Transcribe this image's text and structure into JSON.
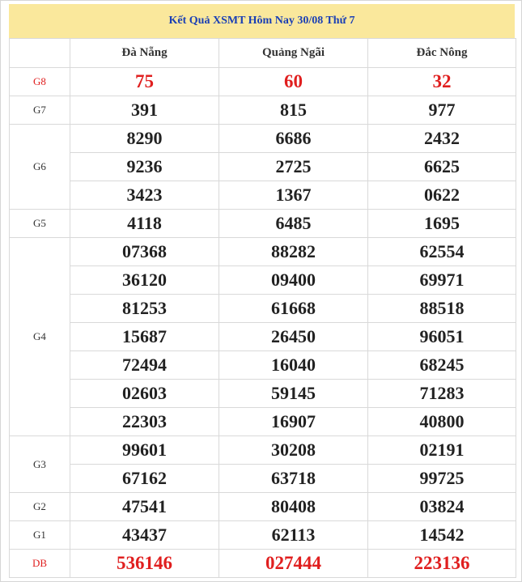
{
  "title": "Kết Quả XSMT Hôm Nay 30/08 Thứ 7",
  "columns": [
    "Đà Nẵng",
    "Quảng Ngãi",
    "Đắc Nông"
  ],
  "prizes": [
    {
      "label": "G8",
      "red": true,
      "rows": [
        [
          "75",
          "60",
          "32"
        ]
      ]
    },
    {
      "label": "G7",
      "red": false,
      "rows": [
        [
          "391",
          "815",
          "977"
        ]
      ]
    },
    {
      "label": "G6",
      "red": false,
      "rows": [
        [
          "8290",
          "6686",
          "2432"
        ],
        [
          "9236",
          "2725",
          "6625"
        ],
        [
          "3423",
          "1367",
          "0622"
        ]
      ]
    },
    {
      "label": "G5",
      "red": false,
      "rows": [
        [
          "4118",
          "6485",
          "1695"
        ]
      ]
    },
    {
      "label": "G4",
      "red": false,
      "rows": [
        [
          "07368",
          "88282",
          "62554"
        ],
        [
          "36120",
          "09400",
          "69971"
        ],
        [
          "81253",
          "61668",
          "88518"
        ],
        [
          "15687",
          "26450",
          "96051"
        ],
        [
          "72494",
          "16040",
          "68245"
        ],
        [
          "02603",
          "59145",
          "71283"
        ],
        [
          "22303",
          "16907",
          "40800"
        ]
      ]
    },
    {
      "label": "G3",
      "red": false,
      "rows": [
        [
          "99601",
          "30208",
          "02191"
        ],
        [
          "67162",
          "63718",
          "99725"
        ]
      ]
    },
    {
      "label": "G2",
      "red": false,
      "rows": [
        [
          "47541",
          "80408",
          "03824"
        ]
      ]
    },
    {
      "label": "G1",
      "red": false,
      "rows": [
        [
          "43437",
          "62113",
          "14542"
        ]
      ]
    },
    {
      "label": "DB",
      "red": true,
      "rows": [
        [
          "536146",
          "027444",
          "223136"
        ]
      ]
    }
  ],
  "colors": {
    "red": "#e01f1f",
    "title_bg": "#fae89c",
    "title_text": "#1a3fb5"
  }
}
